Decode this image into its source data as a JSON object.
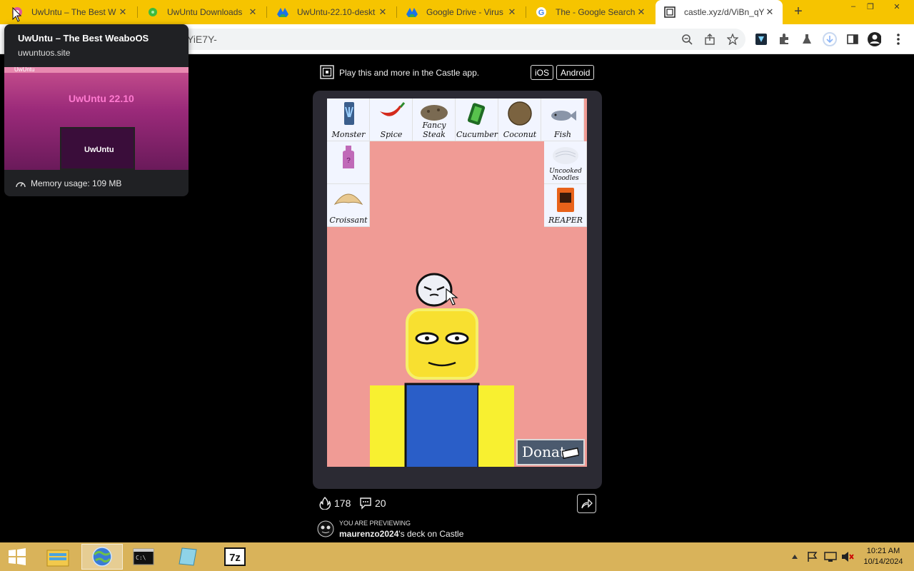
{
  "browser": {
    "tabs": [
      {
        "title": "UwUntu – The Best W",
        "active": false
      },
      {
        "title": "UwUntu Downloads",
        "active": false
      },
      {
        "title": "UwUntu-22.10-deskt",
        "active": false
      },
      {
        "title": "Google Drive - Virus",
        "active": false
      },
      {
        "title": "The - Google Search",
        "active": false
      },
      {
        "title": "castle.xyz/d/ViBn_qY",
        "active": true
      }
    ],
    "new_tab_label": "+",
    "url_visible": "YiE7Y-",
    "window_controls": [
      "–",
      "❐",
      "✕"
    ]
  },
  "tooltip": {
    "title": "UwUntu – The Best WeaboOS",
    "domain": "uwuntuos.site",
    "preview_brand": "UwUntu",
    "preview_heading": "UwUntu 22.10",
    "preview_screen_text": "UwUntu",
    "memory": "Memory usage: 109 MB"
  },
  "castle": {
    "banner_text": "Play this and more in the Castle app.",
    "ios_label": "iOS",
    "android_label": "Android",
    "items": [
      {
        "label": "Monster"
      },
      {
        "label": "Spice"
      },
      {
        "label": "Fancy Steak"
      },
      {
        "label": "Cucumber"
      },
      {
        "label": "Coconut"
      },
      {
        "label": "Fish"
      },
      {
        "label": ""
      },
      {
        "label": "Uncooked Noodles"
      },
      {
        "label": "Croissant"
      },
      {
        "label": "REAPER"
      }
    ],
    "donate_label": "Donate",
    "likes": "178",
    "comments": "20",
    "preview_small": "YOU ARE PREVIEWING",
    "deck_owner": "maurenzo2024",
    "deck_suffix": "'s deck on Castle"
  },
  "taskbar": {
    "time": "10:21 AM",
    "date": "10/14/2024",
    "apps": [
      "start",
      "file-explorer",
      "chrome",
      "cmd",
      "notepad",
      "7zip"
    ]
  },
  "colors": {
    "tabstrip": "#f6c400",
    "game_bg": "#f09b95",
    "card_bg": "#2b2a33",
    "taskbar": "#d9b35a"
  }
}
